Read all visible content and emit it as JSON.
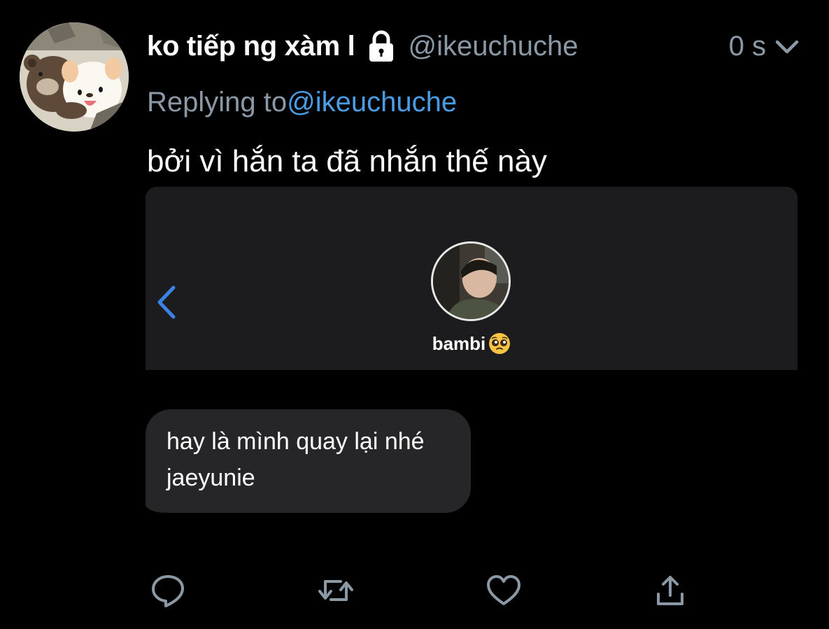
{
  "tweet": {
    "display_name": "ko tiếp ng xàm l",
    "handle": "@ikeuchuche",
    "time": "0 s",
    "replying_prefix": "Replying to",
    "replying_mention": "@ikeuchuche",
    "text": "bởi vì hắn ta đã nhắn thế này",
    "icons": {
      "avatar": "bear-dog-cartoon-avatar",
      "lock": "lock-icon",
      "menu": "chevron-down-icon"
    }
  },
  "media": {
    "contact_name": "bambi",
    "contact_emoji": "pleading-face-emoji",
    "message": "hay là mình quay lại nhé jaeyunie",
    "icons": {
      "back": "back-arrow-icon",
      "contact_avatar": "contact-photo"
    }
  },
  "actions": [
    {
      "name": "reply",
      "icon": "reply-icon"
    },
    {
      "name": "retweet",
      "icon": "retweet-icon"
    },
    {
      "name": "like",
      "icon": "heart-icon"
    },
    {
      "name": "share",
      "icon": "share-icon"
    }
  ],
  "colors": {
    "background": "#000000",
    "muted_text": "#8b98a5",
    "mention": "#4a9de5",
    "back_arrow": "#3b82e6",
    "bubble": "#262629",
    "media_header": "#1c1c1e"
  }
}
